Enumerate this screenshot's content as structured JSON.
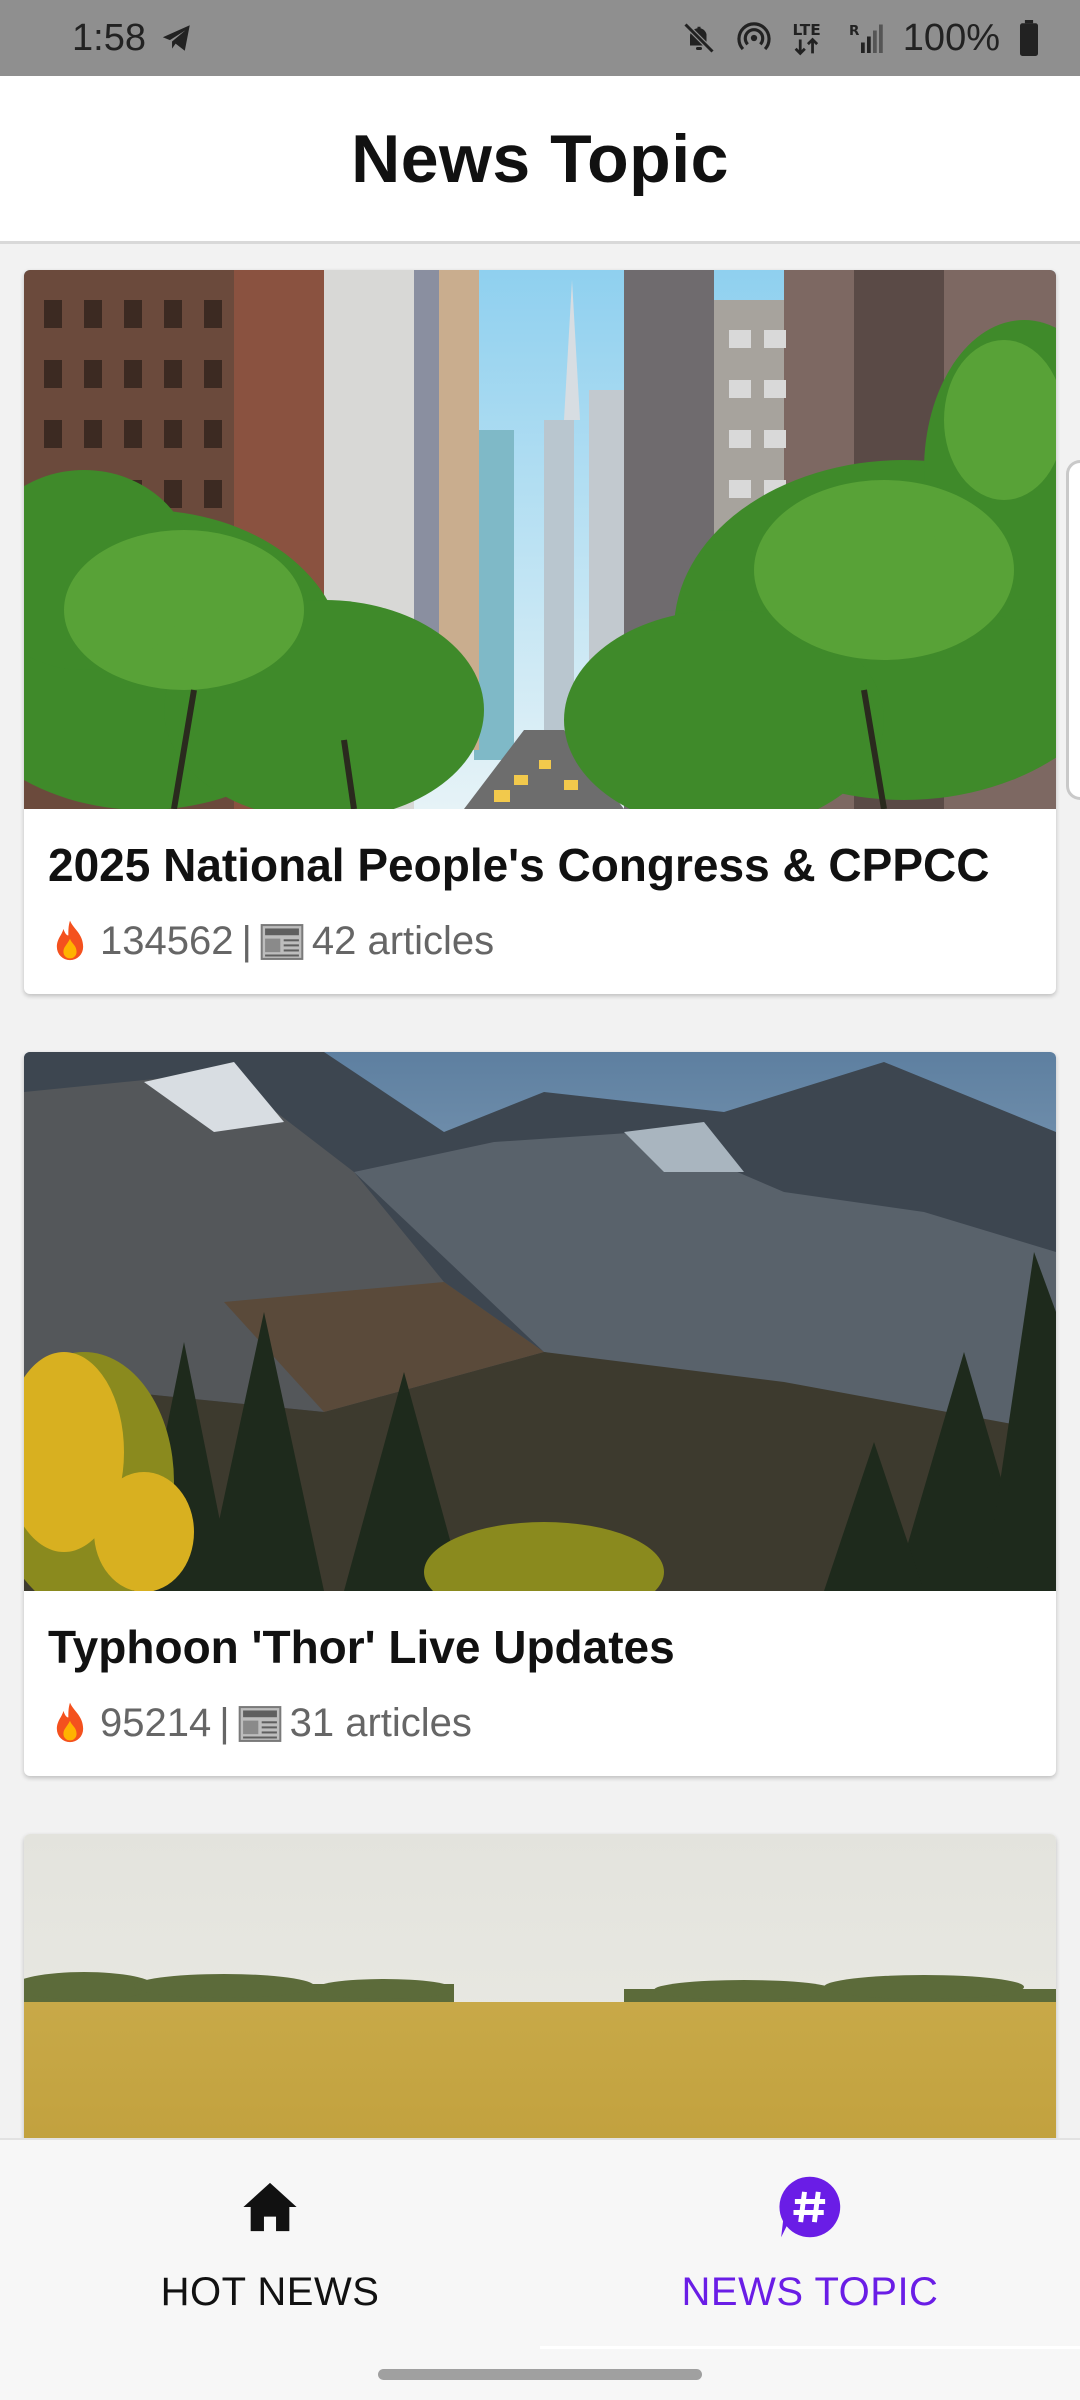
{
  "status_bar": {
    "time": "1:58",
    "battery": "100%",
    "icons": [
      "telegram-icon",
      "mute-icon",
      "hotspot-icon",
      "lte-icon",
      "signal-icon",
      "battery-icon"
    ]
  },
  "app_bar": {
    "title": "News Topic"
  },
  "topics": [
    {
      "title": "2025 National People's Congress & CPPCC",
      "heat": "134562",
      "separator": "|",
      "articles": "42 articles",
      "image": "city-street-photo"
    },
    {
      "title": "Typhoon 'Thor' Live Updates",
      "heat": "95214",
      "separator": "|",
      "articles": "31 articles",
      "image": "mountain-landscape-photo"
    },
    {
      "title": "",
      "heat": "",
      "separator": "",
      "articles": "",
      "image": "wheat-field-photo"
    }
  ],
  "bottom_nav": {
    "items": [
      {
        "label": "HOT NEWS",
        "icon": "home-icon",
        "active": false
      },
      {
        "label": "NEWS TOPIC",
        "icon": "hashtag-icon",
        "active": true
      }
    ]
  },
  "colors": {
    "accent": "#6a1de6",
    "status_bar_bg": "#8f8f8f",
    "text_primary": "#111111",
    "text_secondary": "#666666"
  }
}
